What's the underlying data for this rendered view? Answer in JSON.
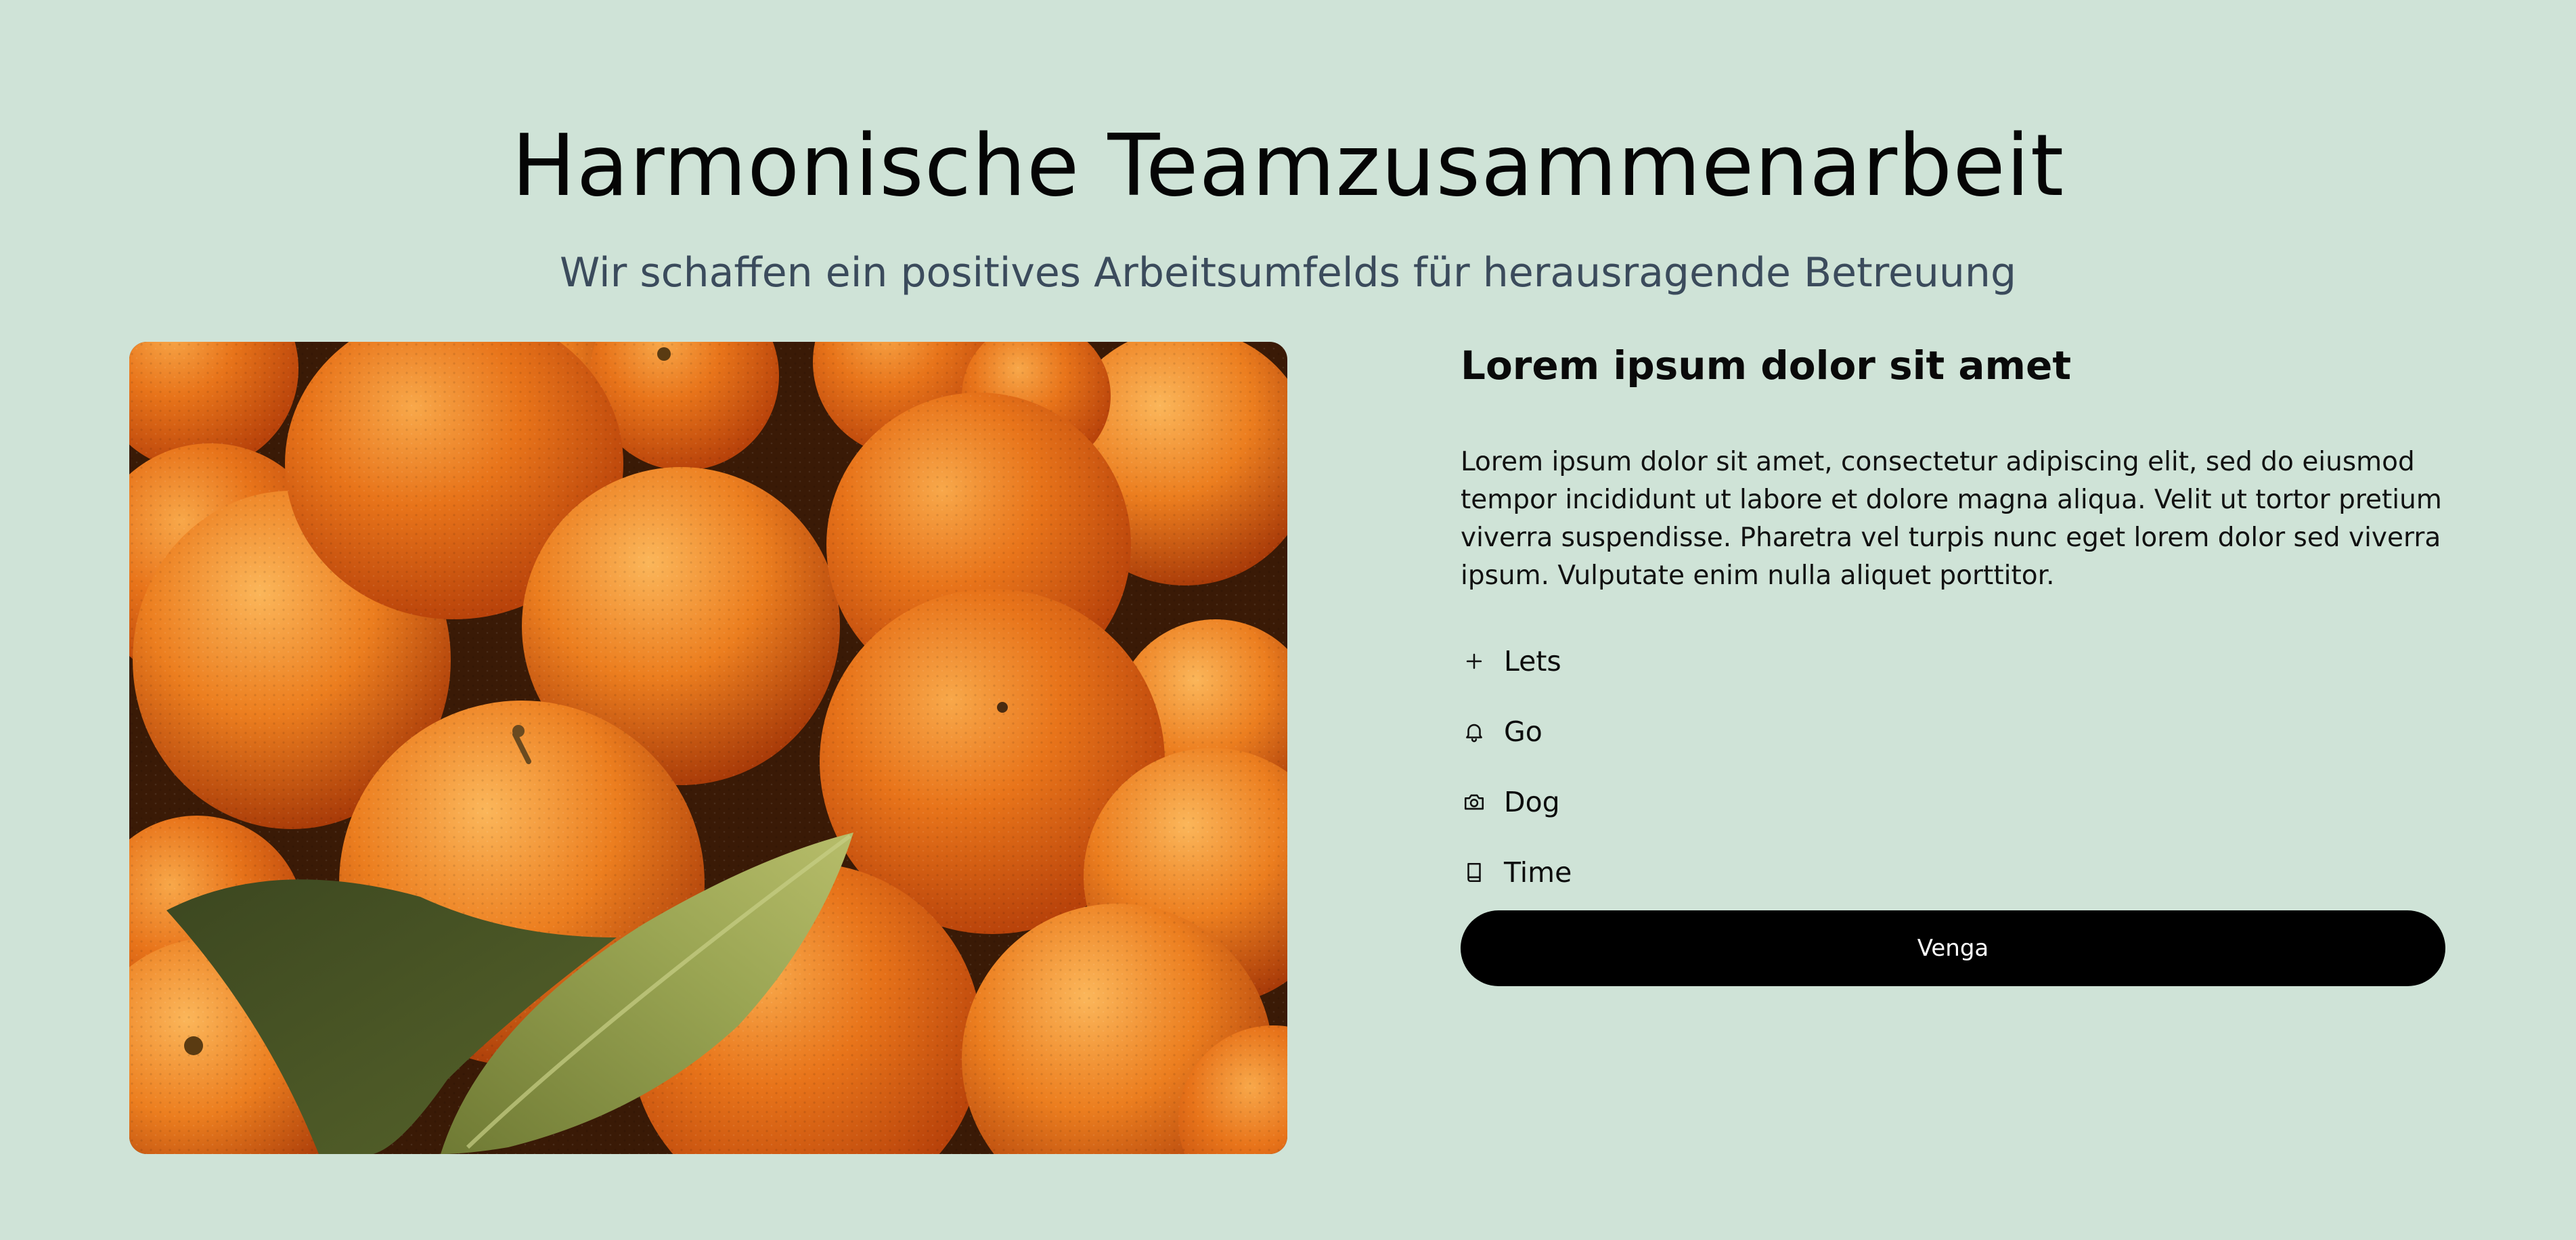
{
  "header": {
    "title": "Harmonische Teamzusammenarbeit",
    "subtitle": "Wir schaffen ein positives Arbeitsumfelds für herausragende Betreuung"
  },
  "media": {
    "image_subject": "oranges-photo"
  },
  "content": {
    "heading": "Lorem ipsum dolor sit amet",
    "body": "Lorem ipsum dolor sit amet, consectetur adipiscing elit, sed do eiusmod tempor incididunt ut labore et dolore magna aliqua. Velit ut tortor pretium viverra suspendisse. Pharetra vel turpis nunc eget lorem dolor sed viverra ipsum. Vulputate enim nulla aliquet porttitor.",
    "features": [
      {
        "label": "Lets",
        "icon": "plus-icon"
      },
      {
        "label": "Go",
        "icon": "bell-icon"
      },
      {
        "label": "Dog",
        "icon": "camera-icon"
      },
      {
        "label": "Time",
        "icon": "book-icon"
      }
    ],
    "cta_label": "Venga"
  },
  "colors": {
    "background": "#cfe3d7",
    "button": "#000000",
    "button_text": "#ffffff",
    "subtitle": "#3b4b5c"
  }
}
